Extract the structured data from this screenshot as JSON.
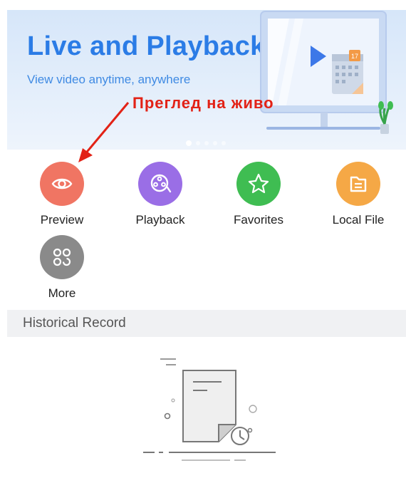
{
  "banner": {
    "title": "Live and Playback",
    "subtitle": "View video anytime, anywhere",
    "calendar_day": "17",
    "active_dot_index": 0,
    "dot_count": 5
  },
  "annotation": {
    "text": "Преглед на живо",
    "color": "#e22216"
  },
  "grid": {
    "items": [
      {
        "label": "Preview",
        "icon": "eye-icon",
        "color": "#f07563"
      },
      {
        "label": "Playback",
        "icon": "film-reel-icon",
        "color": "#9a6ee6"
      },
      {
        "label": "Favorites",
        "icon": "star-icon",
        "color": "#3fbd52"
      },
      {
        "label": "Local File",
        "icon": "folder-file-icon",
        "color": "#f5a846"
      },
      {
        "label": "More",
        "icon": "apps-grid-icon",
        "color": "#8a8a8a"
      }
    ]
  },
  "history": {
    "header": "Historical Record"
  },
  "colors": {
    "accent": "#2b7ce6",
    "section_bg": "#f0f1f3"
  }
}
